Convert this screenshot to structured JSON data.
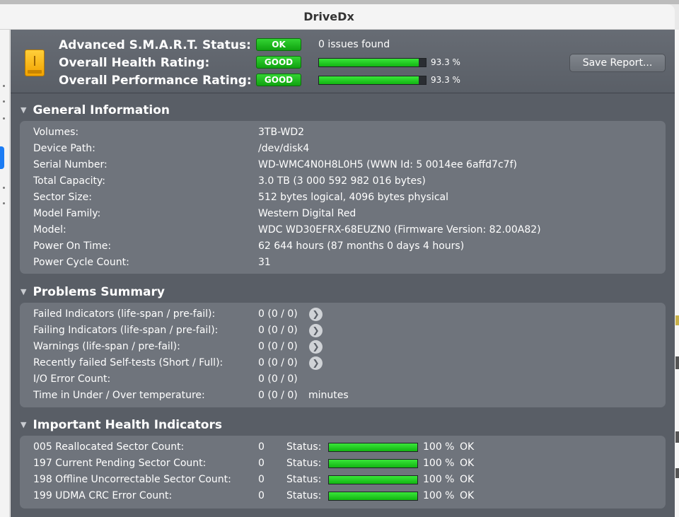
{
  "window": {
    "title": "DriveDx"
  },
  "header": {
    "smart_label": "Advanced S.M.A.R.T. Status:",
    "smart_badge": "OK",
    "smart_text": "0 issues found",
    "health_label": "Overall Health Rating:",
    "health_badge": "GOOD",
    "health_pct": "93.3 %",
    "health_value": 93.3,
    "perf_label": "Overall Performance Rating:",
    "perf_badge": "GOOD",
    "perf_pct": "93.3 %",
    "perf_value": 93.3,
    "save_label": "Save Report..."
  },
  "general": {
    "title": "General Information",
    "rows": [
      {
        "k": "Volumes:",
        "v": "3TB-WD2"
      },
      {
        "k": "Device Path:",
        "v": "/dev/disk4"
      },
      {
        "k": "Serial Number:",
        "v": "WD-WMC4N0H8L0H5 (WWN Id: 5 0014ee 6affd7c7f)"
      },
      {
        "k": "Total Capacity:",
        "v": "3.0 TB (3 000 592 982 016 bytes)"
      },
      {
        "k": "Sector Size:",
        "v": "512 bytes logical, 4096 bytes physical"
      },
      {
        "k": "Model Family:",
        "v": "Western Digital Red"
      },
      {
        "k": "Model:",
        "v": "WDC WD30EFRX-68EUZN0  (Firmware Version: 82.00A82)"
      },
      {
        "k": "Power On Time:",
        "v": "62 644 hours (87 months 0 days 4 hours)"
      },
      {
        "k": "Power Cycle Count:",
        "v": "31"
      }
    ]
  },
  "problems": {
    "title": "Problems Summary",
    "rows": [
      {
        "k": "Failed Indicators (life-span / pre-fail):",
        "v": "0 (0 / 0)"
      },
      {
        "k": "Failing Indicators (life-span / pre-fail):",
        "v": "0 (0 / 0)"
      },
      {
        "k": "Warnings (life-span / pre-fail):",
        "v": "0 (0 / 0)"
      },
      {
        "k": "Recently failed Self-tests (Short / Full):",
        "v": "0 (0 / 0)"
      },
      {
        "k": "I/O Error Count:",
        "v": "0 (0 / 0)"
      },
      {
        "k": "Time in Under / Over temperature:",
        "v": "0 (0 / 0)",
        "unit": "minutes"
      }
    ],
    "arrow_glyph": "❯"
  },
  "health": {
    "title": "Important Health Indicators",
    "status_label": "Status:",
    "rows": [
      {
        "k": "005  Reallocated Sector Count:",
        "v": "0",
        "pct": "100 %",
        "value": 100,
        "state": "OK"
      },
      {
        "k": "197  Current Pending Sector Count:",
        "v": "0",
        "pct": "100 %",
        "value": 100,
        "state": "OK"
      },
      {
        "k": "198  Offline Uncorrectable Sector Count:",
        "v": "0",
        "pct": "100 %",
        "value": 100,
        "state": "OK"
      },
      {
        "k": "199  UDMA CRC Error Count:",
        "v": "0",
        "pct": "100 %",
        "value": 100,
        "state": "OK"
      }
    ]
  },
  "colors": {
    "panel": "#595e66",
    "box": "#6f747c",
    "good_green": "#1fc21f"
  }
}
